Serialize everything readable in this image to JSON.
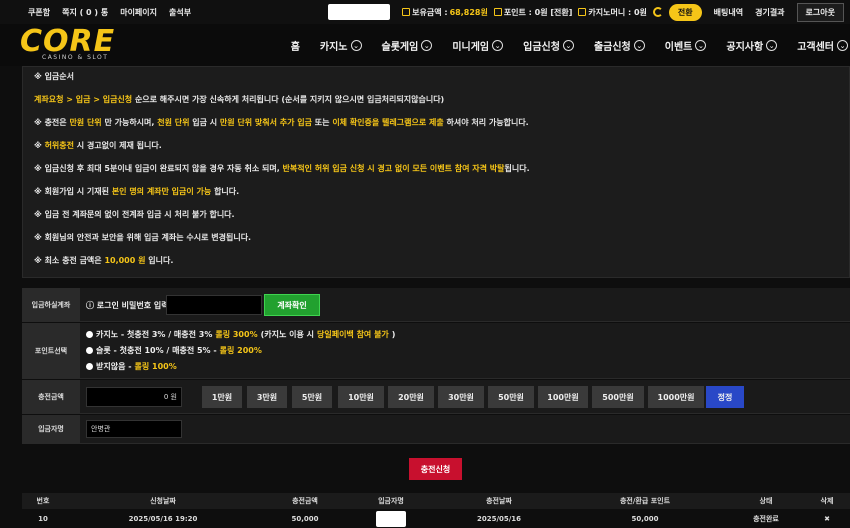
{
  "topbar": {
    "links": [
      "쿠폰함",
      "쪽지 ( 0 ) 통",
      "마이페이지",
      "출석부"
    ],
    "balance_label": "보유금액 :",
    "balance_value": "68,828원",
    "point_label": "포인트 : 0원 [전환]",
    "casino_label": "카지노머니 : 0원",
    "convert_label": "전환",
    "bet_history": "배팅내역",
    "results": "경기결과",
    "logout": "로그아웃"
  },
  "logo": {
    "word": "CORE",
    "sub": "CASINO & SLOT"
  },
  "nav": [
    "홈",
    "카지노",
    "슬롯게임",
    "미니게임",
    "입금신청",
    "출금신청",
    "이벤트",
    "공지사항",
    "고객센터"
  ],
  "info": {
    "title": "※ 입금순서",
    "l1a": "계좌요청 > 입금 > 입금신청",
    "l1b": " 순으로 해주시면 가장 신속하게 처리됩니다 (순서를 지키지 않으시면 입금처리되지않습니다)",
    "l2a": "※ 충전은 ",
    "l2b": "만원 단위",
    "l2c": " 만 가능하시며, ",
    "l2d": "천원 단위",
    "l2e": " 입금 시 ",
    "l2f": "만원 단위 맞춰서 추가 입금",
    "l2g": " 또는 ",
    "l2h": "이체 확인증을 텔레그램으로 제출",
    "l2i": " 하셔야 처리 가능합니다.",
    "l3a": "※ ",
    "l3b": "허위충전",
    "l3c": " 시 경고없이 제재 됩니다.",
    "l4a": "※ 입금신청 후 최대 5분이내 입금이 완료되지 않을 경우 자동 취소 되며, ",
    "l4b": "반복적인 허위 입금 신청 시 경고 없이 모든 이벤트 참여 자격 박탈",
    "l4c": "됩니다.",
    "l5a": "※ 회원가입 시 기재된 ",
    "l5b": "본인 명의 계좌만 입금이 가능",
    "l5c": " 합니다.",
    "l6": "※ 입금 전 계좌문의 없이 전계좌 입금 시 처리 불가 합니다.",
    "l7": "※ 회원님의 안전과 보안을 위해 입금 계좌는 수시로 변경됩니다.",
    "l8a": "※ 최소 충전 금액은 ",
    "l8b": "10,000 원",
    "l8c": " 입니다."
  },
  "form": {
    "account_label": "입금하실계좌",
    "pw_label": "ⓘ 로그인 비밀번호 입력",
    "account_btn": "계좌확인",
    "point_label": "포인트선택",
    "opt1a": "카지노 - 첫충전 3% / 매충전 3% ",
    "opt1b": "롤링 300%",
    "opt1c": " (카지노 이용 시 ",
    "opt1d": "당일페이백 참여 불가",
    "opt1e": ")",
    "opt2a": "슬롯 - 첫충전 10% / 매충전 5% - ",
    "opt2b": "롤링 200%",
    "opt3a": "받지않음 - ",
    "opt3b": "롤링 100%",
    "amount_label": "충전금액",
    "amount_value": "0 원",
    "chips": [
      "1만원",
      "3만원",
      "5만원",
      "10만원",
      "20만원",
      "30만원",
      "50만원",
      "100만원",
      "500만원",
      "1000만원"
    ],
    "reset": "정정",
    "depositor_label": "입금자명",
    "depositor_value": "안병관",
    "submit": "충전신청"
  },
  "table": {
    "headers": [
      "번호",
      "신청날짜",
      "충전금액",
      "입금자명",
      "충전날짜",
      "충전/환급 포인트",
      "상태",
      "삭제"
    ],
    "row": [
      "10",
      "2025/05/16 19:20",
      "50,000",
      "",
      "2025/05/16",
      "50,000",
      "충전완료",
      "✖"
    ]
  },
  "colors": {
    "accent": "#f5c518",
    "green": "#22a12f",
    "red": "#c8102e",
    "blue": "#2948c7"
  }
}
